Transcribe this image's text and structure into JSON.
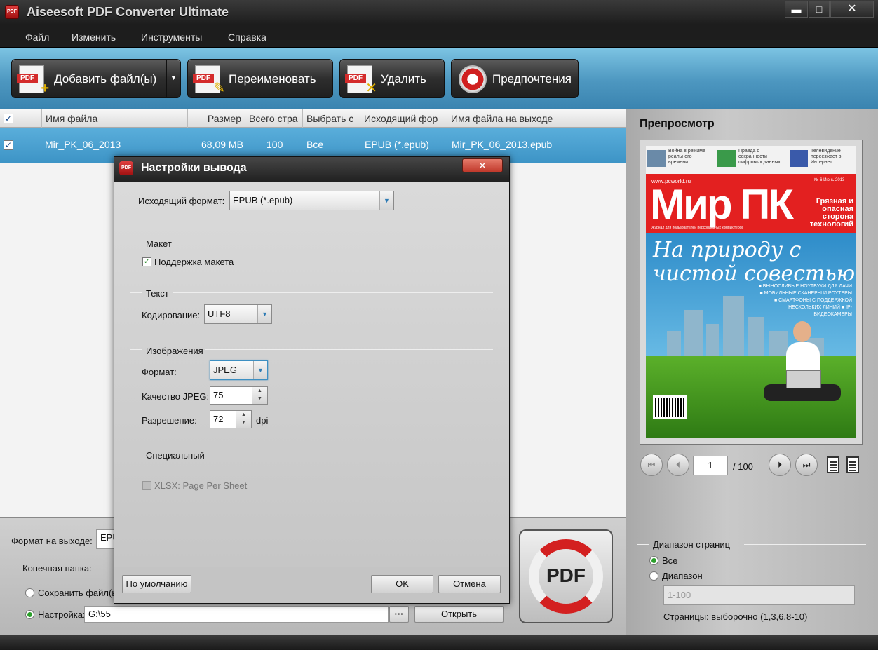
{
  "window": {
    "title": "Aiseesoft PDF Converter Ultimate",
    "icon_text": "PDF",
    "min": "▬",
    "max": "□",
    "close": "✕"
  },
  "menu": [
    "Файл",
    "Изменить",
    "Инструменты",
    "Справка"
  ],
  "toolbar": {
    "add_label": "Добавить файл(ы)",
    "add_dropdown": "▼",
    "rename_label": "Переименовать",
    "delete_label": "Удалить",
    "prefs_label": "Предпочтения",
    "pdf_tag": "PDF"
  },
  "table": {
    "columns": [
      "Имя файла",
      "Размер",
      "Всего стра",
      "Выбрать с",
      "Исходящий фор",
      "Имя файла на выходе"
    ],
    "rows": [
      {
        "checked": "✓",
        "name": "Mir_PK_06_2013",
        "size": "68,09 MB",
        "pages": "100",
        "select": "Все",
        "format": "EPUB (*.epub)",
        "output": "Mir_PK_06_2013.epub"
      }
    ],
    "header_check": "✓"
  },
  "bottom": {
    "output_format_label": "Формат на выходе:",
    "output_format_value": "EPU",
    "dest_label": "Конечная папка:",
    "save_option": "Сохранить файл(ы",
    "custom_option": "Настройка:",
    "custom_path": "G:\\55",
    "browse": "···",
    "open": "Открыть",
    "convert_icon_text": "PDF"
  },
  "preview": {
    "title": "Препросмотр",
    "page_current": "1",
    "page_total": "/ 100",
    "nav_first": "⏮",
    "nav_prev": "⏴",
    "nav_next": "⏵",
    "nav_last": "⏭",
    "range_title": "Диапазон страниц",
    "range_all": "Все",
    "range_custom": "Диапазон",
    "range_placeholder": "1-100",
    "range_hint": "Страницы: выборочно (1,3,6,8-10)",
    "cover": {
      "teaser1": "Война в режиме реального времени",
      "teaser2": "Правда о сохранности цифровых данных",
      "teaser3": "Телевидение переезжает в Интернет",
      "url": "www.pcworld.ru",
      "issue": "№ 6 Июнь 2013",
      "logo": "Мир ПК",
      "side_text": "Грязная и опасная сторона технологий",
      "tagline": "Журнал для пользователей персональных компьютеров",
      "headline": "На природу с чистой совестью",
      "bullets": "■ ВЫНОСЛИВЫЕ НОУТБУКИ ДЛЯ ДАЧИ ■ МОБИЛЬНЫЕ СКАНЕРЫ И РОУТЕРЫ ■ СМАРТФОНЫ С ПОДДЕРЖКОЙ НЕСКОЛЬКИХ ЛИНИЙ ■ IP-ВИДЕОКАМЕРЫ"
    }
  },
  "dialog": {
    "title": "Настройки вывода",
    "icon_text": "PDF",
    "close": "✕",
    "output_format_label": "Исходящий формат:",
    "output_format_value": "EPUB (*.epub)",
    "layout_group": "Макет",
    "layout_support": "Поддержка макета",
    "layout_checked": "✓",
    "text_group": "Текст",
    "encoding_label": "Кодирование:",
    "encoding_value": "UTF8",
    "images_group": "Изображения",
    "format_label": "Формат:",
    "format_value": "JPEG",
    "quality_label": "Качество JPEG:",
    "quality_value": "75",
    "resolution_label": "Разрешение:",
    "resolution_value": "72",
    "dpi": "dpi",
    "special_group": "Специальный",
    "xlsx_label": "XLSX: Page Per Sheet",
    "default_btn": "По умолчанию",
    "ok_btn": "OK",
    "cancel_btn": "Отмена",
    "arrow": "▼",
    "spin_up": "▲",
    "spin_down": "▼"
  }
}
